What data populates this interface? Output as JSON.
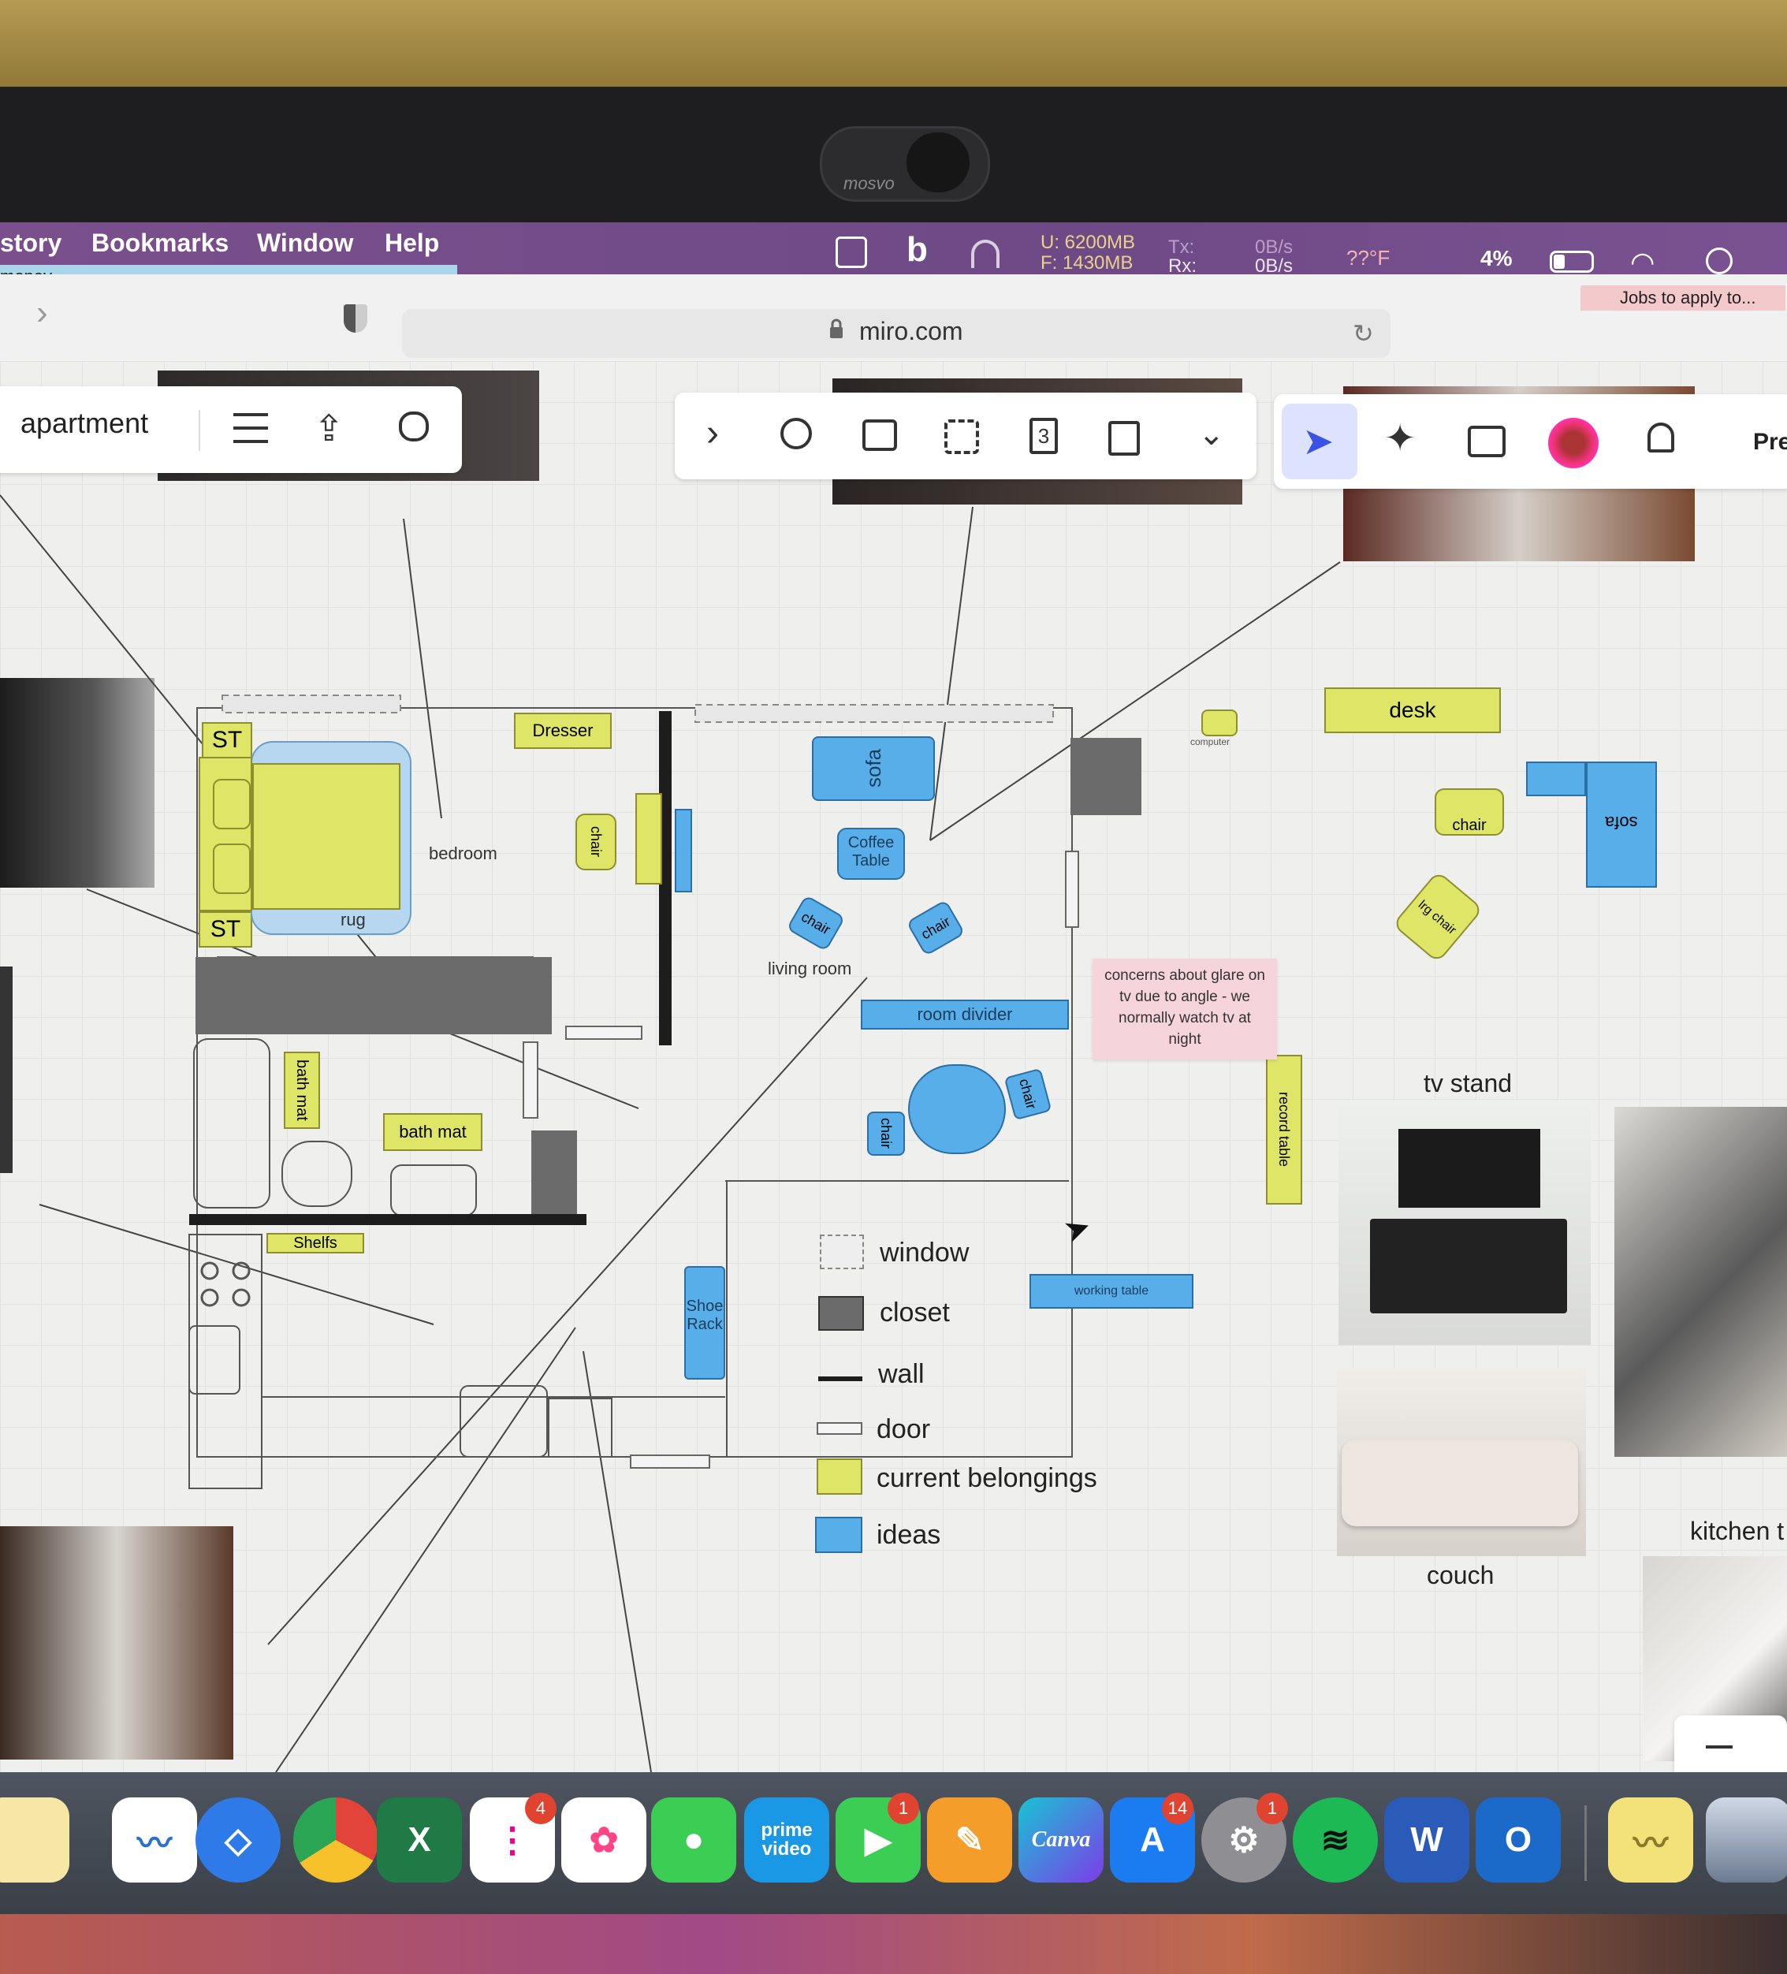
{
  "menubar": {
    "items": [
      "story",
      "Bookmarks",
      "Window",
      "Help"
    ],
    "status": {
      "mem_used": "U: 6200MB",
      "mem_free": "F: 1430MB",
      "tx": "Tx:",
      "rx": "Rx:",
      "tx_rate": "0B/s",
      "rx_rate": "0B/s",
      "temp": "??°F",
      "battery": "4%"
    },
    "progress_label": "money...",
    "notification": "Jobs to apply to..."
  },
  "webcam_cover": {
    "label": "mosvo"
  },
  "browser": {
    "url": "miro.com"
  },
  "miro": {
    "board_name": "apartment",
    "right_cut_label": "Pre"
  },
  "floorplan": {
    "labels": {
      "st_top": "ST",
      "st_bottom": "ST",
      "dresser": "Dresser",
      "bedroom": "bedroom",
      "rug": "rug",
      "chair_bedroom": "chair",
      "sofa": "sofa",
      "coffee_table": "Coffee Table",
      "chair_left": "chair",
      "chair_right": "chair",
      "living_room": "living room",
      "room_divider": "room divider",
      "chair_dining_left": "chair",
      "chair_dining_right": "chair",
      "bath_mat_vertical": "bath mat",
      "bath_mat": "bath mat",
      "shelfs": "Shelfs",
      "shoe_rack": "Shoe Rack",
      "working_table": "working table",
      "record_table": "record table",
      "computer": "computer",
      "desk": "desk",
      "chair_desk": "chair",
      "sofa_right": "sofa",
      "lrg_chair": "lrg chair"
    },
    "sticky_note": "concerns about glare on tv due to angle - we normally watch tv at night"
  },
  "legend": {
    "items": [
      {
        "label": "window"
      },
      {
        "label": "closet"
      },
      {
        "label": "wall"
      },
      {
        "label": "door"
      },
      {
        "label": "current belongings",
        "color": "#dfe566"
      },
      {
        "label": "ideas",
        "color": "#58aee8"
      }
    ]
  },
  "moodboard": {
    "tv_stand": "tv stand",
    "couch": "couch",
    "kitchen": "kitchen t"
  },
  "dock": {
    "badges": {
      "reminders": "4",
      "facetime": "1",
      "appstore": "14",
      "settings": "1"
    },
    "prime_label": "prime video",
    "canva_label": "Canva"
  }
}
